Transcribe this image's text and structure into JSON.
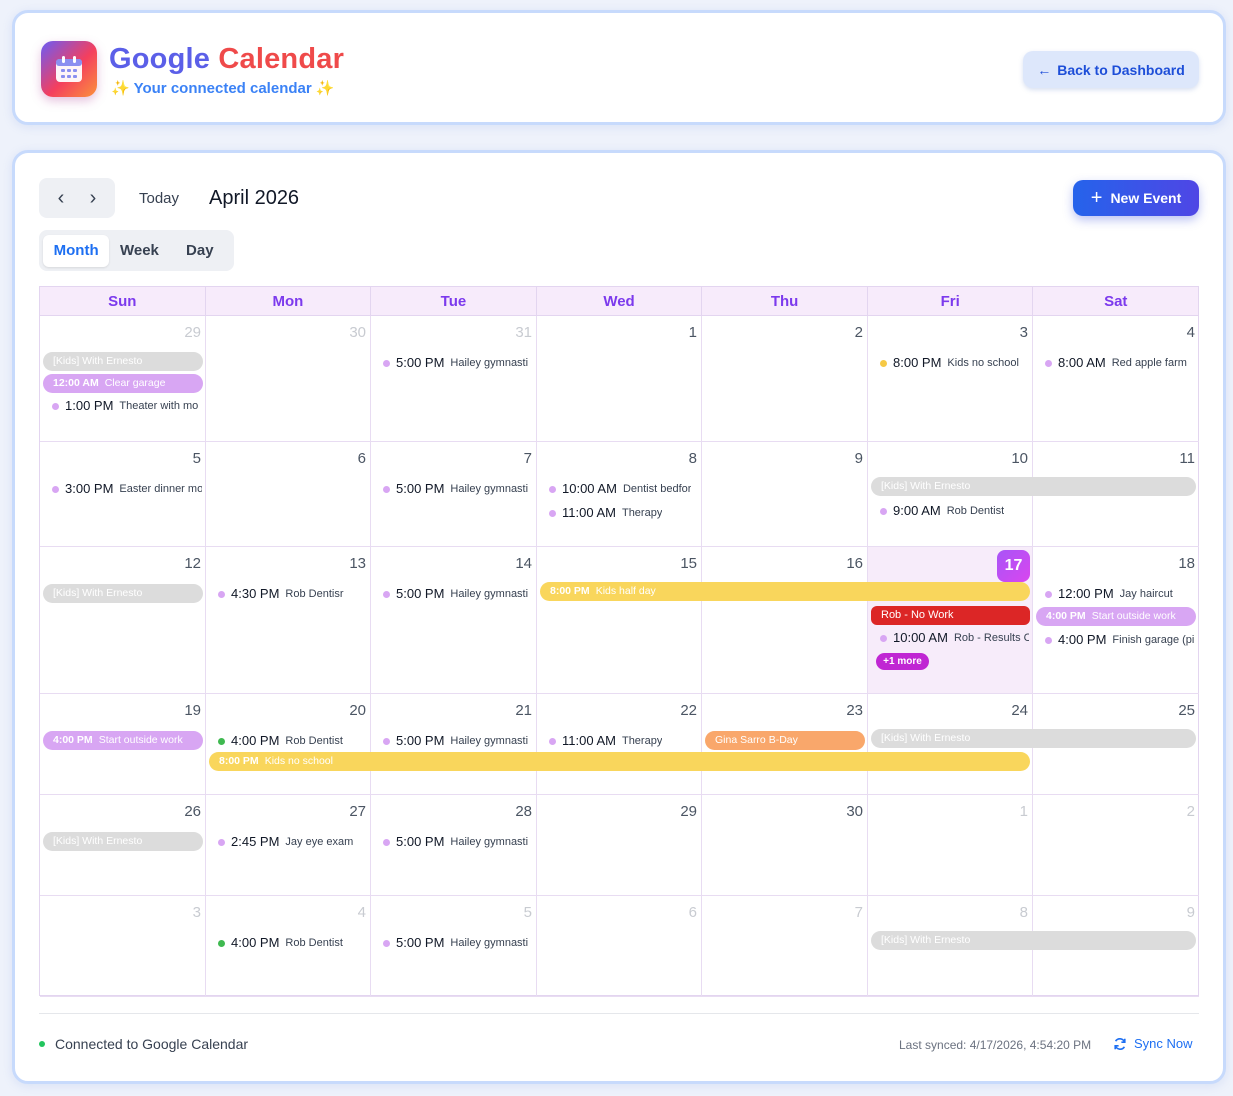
{
  "header": {
    "title_part1": "Google",
    "title_part2": "Calendar",
    "subtitle": "Your connected calendar",
    "sparkle": "✨",
    "back_button": "Back to Dashboard",
    "back_arrow": "←"
  },
  "toolbar": {
    "prev": "‹",
    "next": "›",
    "today": "Today",
    "month_label": "April 2026",
    "new_event_plus": "+",
    "new_event": "New Event",
    "views": [
      "Month",
      "Week",
      "Day"
    ],
    "active_view": "Month"
  },
  "weekdays": [
    "Sun",
    "Mon",
    "Tue",
    "Wed",
    "Thu",
    "Fri",
    "Sat"
  ],
  "weeks": [
    {
      "days": [
        {
          "num": "29",
          "muted": true
        },
        {
          "num": "30",
          "muted": true
        },
        {
          "num": "31",
          "muted": true
        },
        {
          "num": "1"
        },
        {
          "num": "2"
        },
        {
          "num": "3"
        },
        {
          "num": "4"
        }
      ]
    },
    {
      "days": [
        {
          "num": "5"
        },
        {
          "num": "6"
        },
        {
          "num": "7"
        },
        {
          "num": "8"
        },
        {
          "num": "9"
        },
        {
          "num": "10"
        },
        {
          "num": "11"
        }
      ]
    },
    {
      "days": [
        {
          "num": "12"
        },
        {
          "num": "13"
        },
        {
          "num": "14"
        },
        {
          "num": "15"
        },
        {
          "num": "16"
        },
        {
          "num": "17",
          "today": true
        },
        {
          "num": "18"
        }
      ]
    },
    {
      "days": [
        {
          "num": "19"
        },
        {
          "num": "20"
        },
        {
          "num": "21"
        },
        {
          "num": "22"
        },
        {
          "num": "23"
        },
        {
          "num": "24"
        },
        {
          "num": "25"
        }
      ]
    },
    {
      "days": [
        {
          "num": "26"
        },
        {
          "num": "27"
        },
        {
          "num": "28"
        },
        {
          "num": "29"
        },
        {
          "num": "30"
        },
        {
          "num": "1",
          "muted": true
        },
        {
          "num": "2",
          "muted": true
        }
      ]
    },
    {
      "days": [
        {
          "num": "3",
          "muted": true
        },
        {
          "num": "4",
          "muted": true
        },
        {
          "num": "5",
          "muted": true
        },
        {
          "num": "6",
          "muted": true
        },
        {
          "num": "7",
          "muted": true
        },
        {
          "num": "8",
          "muted": true
        },
        {
          "num": "9",
          "muted": true
        }
      ]
    }
  ],
  "events": {
    "w1_bar_with_ernesto": {
      "title": "[Kids] With Ernesto",
      "color": "#dcdcdc"
    },
    "w1_clear_garage": {
      "time": "12:00 AM",
      "title": "Clear garage",
      "color": "#d8a6f3"
    },
    "w1_theater": {
      "time": "1:00 PM",
      "title": "Theater with mo",
      "color": "#d8a6f3"
    },
    "w1_hailey": {
      "time": "5:00 PM",
      "title": "Hailey gymnasti",
      "color": "#d8a6f3"
    },
    "w1_kids_no_school": {
      "time": "8:00 PM",
      "title": "Kids no school",
      "color": "#f6c945"
    },
    "w1_apple_farm": {
      "time": "8:00 AM",
      "title": "Red apple farm",
      "color": "#d8a6f3"
    },
    "w2_easter": {
      "time": "3:00 PM",
      "title": "Easter dinner mo",
      "color": "#d8a6f3"
    },
    "w2_hailey": {
      "time": "5:00 PM",
      "title": "Hailey gymnasti",
      "color": "#d8a6f3"
    },
    "w2_dentist_before": {
      "time": "10:00 AM",
      "title": "Dentist bedfor",
      "color": "#d8a6f3"
    },
    "w2_therapy": {
      "time": "11:00 AM",
      "title": "Therapy",
      "color": "#d8a6f3"
    },
    "w2_with_ernesto": {
      "title": "[Kids] With Ernesto",
      "color": "#dcdcdc"
    },
    "w2_rob_dentist": {
      "time": "9:00 AM",
      "title": "Rob Dentist",
      "color": "#d8a6f3"
    },
    "w3_with_ernesto": {
      "title": "[Kids] With Ernesto",
      "color": "#dcdcdc"
    },
    "w3_rob_dentisr": {
      "time": "4:30 PM",
      "title": "Rob Dentisr",
      "color": "#d8a6f3"
    },
    "w3_hailey": {
      "time": "5:00 PM",
      "title": "Hailey gymnasti",
      "color": "#d8a6f3"
    },
    "w3_kids_half_day": {
      "time": "8:00 PM",
      "title": "Kids half day",
      "color": "#f9d65c"
    },
    "w3_rob_no_work": {
      "title": "Rob - No Work",
      "color": "#dc2626"
    },
    "w3_rob_results": {
      "time": "10:00 AM",
      "title": "Rob - Results C",
      "color": "#d8a6f3"
    },
    "w3_more": {
      "title": "+1 more"
    },
    "w3_jay_haircut": {
      "time": "12:00 PM",
      "title": "Jay haircut",
      "color": "#d8a6f3"
    },
    "w3_start_outside": {
      "time": "4:00 PM",
      "title": "Start outside work",
      "color": "#d8a6f3"
    },
    "w3_finish_garage": {
      "time": "4:00 PM",
      "title": "Finish garage (pi",
      "color": "#d8a6f3"
    },
    "w4_start_outside": {
      "time": "4:00 PM",
      "title": "Start outside work",
      "color": "#d8a6f3"
    },
    "w4_rob_dentist": {
      "time": "4:00 PM",
      "title": "Rob Dentist",
      "color": "#3fb950"
    },
    "w4_hailey": {
      "time": "5:00 PM",
      "title": "Hailey gymnasti",
      "color": "#d8a6f3"
    },
    "w4_therapy": {
      "time": "11:00 AM",
      "title": "Therapy",
      "color": "#d8a6f3"
    },
    "w4_gina": {
      "title": "Gina Sarro B-Day",
      "color": "#f9a76b"
    },
    "w4_with_ernesto": {
      "title": "[Kids] With Ernesto",
      "color": "#dcdcdc"
    },
    "w4_kids_no_school": {
      "time": "8:00 PM",
      "title": "Kids no school",
      "color": "#f9d65c"
    },
    "w5_with_ernesto": {
      "title": "[Kids] With Ernesto",
      "color": "#dcdcdc"
    },
    "w5_jay_eye": {
      "time": "2:45 PM",
      "title": "Jay eye exam",
      "color": "#d8a6f3"
    },
    "w5_hailey": {
      "time": "5:00 PM",
      "title": "Hailey gymnasti",
      "color": "#d8a6f3"
    },
    "w6_rob_dentist": {
      "time": "4:00 PM",
      "title": "Rob Dentist",
      "color": "#3fb950"
    },
    "w6_hailey": {
      "time": "5:00 PM",
      "title": "Hailey gymnasti",
      "color": "#d8a6f3"
    },
    "w6_with_ernesto": {
      "title": "[Kids] With Ernesto",
      "color": "#dcdcdc"
    }
  },
  "footer": {
    "status": "Connected to Google Calendar",
    "last_synced": "Last synced: 4/17/2026, 4:54:20 PM",
    "sync_now": "Sync Now"
  },
  "colors": {
    "accent": "#1d6ff2",
    "today_gradient_start": "#a855f7",
    "weekday_text": "#7c3aed"
  }
}
